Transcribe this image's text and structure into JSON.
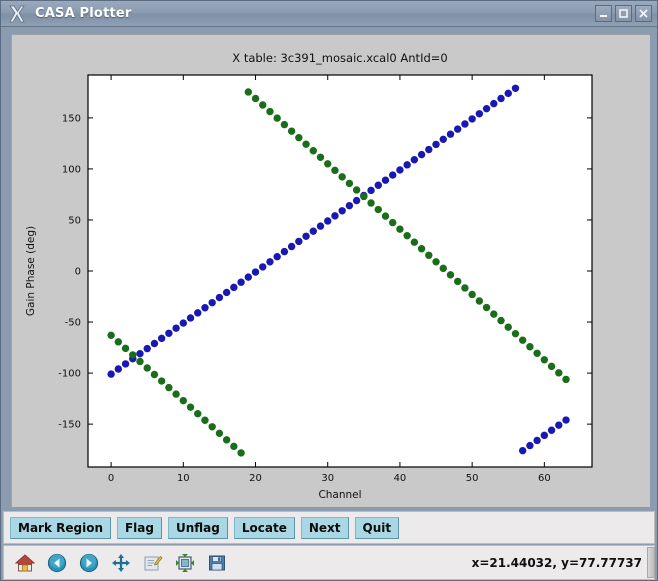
{
  "window": {
    "title": "CASA Plotter",
    "app_icon": "x-logo-icon",
    "minimize_label": "_",
    "maximize_label": "□",
    "close_label": "✕"
  },
  "status": {
    "coordinates": "x=21.44032, y=77.77737"
  },
  "buttons": [
    {
      "id": "mark-region",
      "label": "Mark Region"
    },
    {
      "id": "flag",
      "label": "Flag"
    },
    {
      "id": "unflag",
      "label": "Unflag"
    },
    {
      "id": "locate",
      "label": "Locate"
    },
    {
      "id": "next",
      "label": "Next"
    },
    {
      "id": "quit",
      "label": "Quit"
    }
  ],
  "toolbar": [
    {
      "id": "home",
      "icon": "home-icon"
    },
    {
      "id": "back",
      "icon": "back-arrow-icon"
    },
    {
      "id": "forward",
      "icon": "forward-arrow-icon"
    },
    {
      "id": "pan",
      "icon": "pan-move-icon"
    },
    {
      "id": "configure-subplots",
      "icon": "edit-subplots-icon"
    },
    {
      "id": "zoom-rect",
      "icon": "zoom-to-rectangle-icon"
    },
    {
      "id": "save",
      "icon": "floppy-save-icon"
    }
  ],
  "colors": {
    "series_blue": "#1818b4",
    "series_green": "#1a6e1a",
    "plot_background": "#ffffff",
    "panel_background": "#c9c9c9",
    "titlebar": "#8b9bb0",
    "button_face": "#a9d8e4"
  },
  "chart_data": {
    "type": "scatter",
    "title": "X table: 3c391_mosaic.xcal0      AntId=0",
    "xlabel": "Channel",
    "ylabel": "Gain Phase (deg)",
    "xlim": [
      -3.2,
      66.6
    ],
    "ylim": [
      -192,
      192
    ],
    "xticks": [
      0,
      10,
      20,
      30,
      40,
      50,
      60
    ],
    "yticks": [
      -150,
      -100,
      -50,
      0,
      50,
      100,
      150
    ],
    "grid": false,
    "legend": null,
    "marker": "circle",
    "marker_size": 5,
    "series": [
      {
        "name": "blue-series",
        "color": "#1818b4",
        "x": [
          0,
          1,
          2,
          3,
          4,
          5,
          6,
          7,
          8,
          9,
          10,
          11,
          12,
          13,
          14,
          15,
          16,
          17,
          18,
          19,
          20,
          21,
          22,
          23,
          24,
          25,
          26,
          27,
          28,
          29,
          30,
          31,
          32,
          33,
          34,
          35,
          36,
          37,
          38,
          39,
          40,
          41,
          42,
          43,
          44,
          45,
          46,
          47,
          48,
          49,
          50,
          51,
          52,
          53,
          54,
          55,
          56,
          57,
          58,
          59,
          60,
          61,
          62,
          63
        ],
        "y": [
          -101.0,
          -96.0,
          -91.0,
          -86.0,
          -81.0,
          -76.0,
          -71.0,
          -66.0,
          -61.0,
          -56.0,
          -51.0,
          -46.0,
          -41.0,
          -36.0,
          -31.0,
          -26.0,
          -21.0,
          -16.0,
          -11.0,
          -6.0,
          -1.0,
          4.0,
          9.0,
          14.0,
          19.0,
          24.0,
          29.0,
          34.0,
          39.0,
          44.0,
          49.0,
          54.0,
          59.0,
          64.0,
          69.0,
          74.0,
          79.0,
          84.0,
          89.0,
          94.0,
          99.0,
          104.0,
          109.0,
          114.0,
          119.0,
          124.0,
          129.0,
          134.0,
          139.0,
          144.0,
          149.0,
          154.0,
          159.0,
          164.0,
          169.0,
          174.0,
          179.0,
          -176.0,
          -171.0,
          -166.0,
          -161.0,
          -156.0,
          -151.0,
          -146.0
        ]
      },
      {
        "name": "green-series",
        "color": "#1a6e1a",
        "x": [
          0,
          1,
          2,
          3,
          4,
          5,
          6,
          7,
          8,
          9,
          10,
          11,
          12,
          13,
          14,
          15,
          16,
          17,
          18,
          19,
          20,
          21,
          22,
          23,
          24,
          25,
          26,
          27,
          28,
          29,
          30,
          31,
          32,
          33,
          34,
          35,
          36,
          37,
          38,
          39,
          40,
          41,
          42,
          43,
          44,
          45,
          46,
          47,
          48,
          49,
          50,
          51,
          52,
          53,
          54,
          55,
          56,
          57,
          58,
          59,
          60,
          61,
          62,
          63
        ],
        "y": [
          -63.0,
          -69.4,
          -75.8,
          -82.2,
          -88.6,
          -95.0,
          -101.4,
          -107.8,
          -114.2,
          -120.6,
          -127.0,
          -133.4,
          -139.8,
          -146.2,
          -152.6,
          -159.0,
          -165.4,
          -171.8,
          -178.2,
          175.4,
          169.0,
          162.6,
          156.2,
          149.8,
          143.4,
          137.0,
          130.6,
          124.2,
          117.8,
          111.4,
          105.0,
          98.6,
          92.2,
          85.8,
          79.4,
          73.0,
          66.6,
          60.2,
          53.8,
          47.4,
          41.0,
          34.6,
          28.2,
          21.8,
          15.4,
          9.0,
          2.6,
          -3.8,
          -10.2,
          -16.6,
          -23.0,
          -29.4,
          -35.8,
          -42.2,
          -48.6,
          -55.0,
          -61.4,
          -67.8,
          -74.2,
          -80.6,
          -87.0,
          -93.4,
          -99.8,
          -106.2
        ]
      }
    ]
  }
}
